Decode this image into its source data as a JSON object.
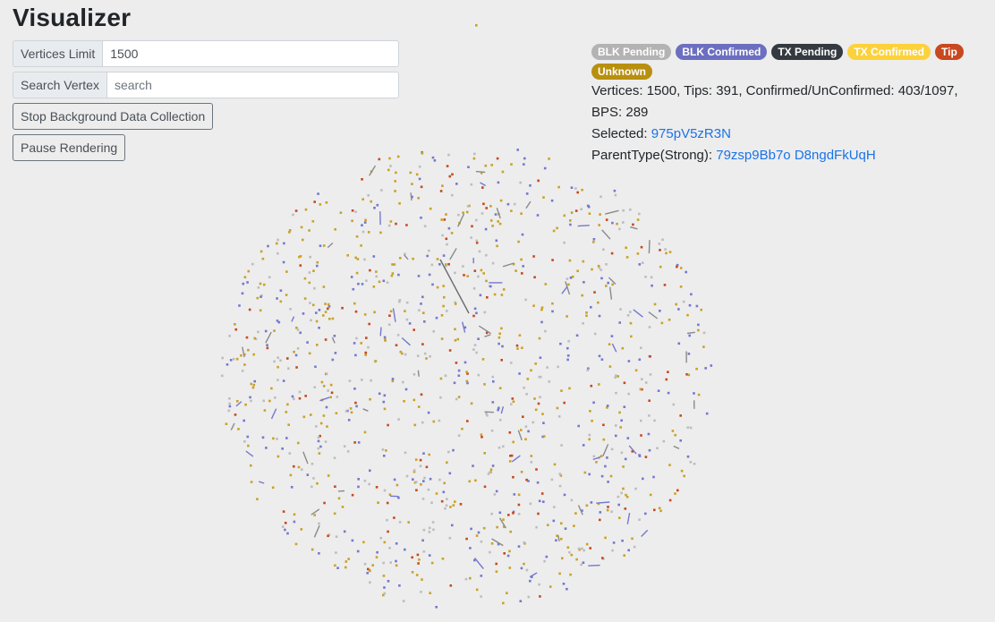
{
  "app": {
    "title": "Visualizer"
  },
  "controls": {
    "vertices_limit": {
      "label": "Vertices Limit",
      "value": "1500"
    },
    "search_vertex": {
      "label": "Search Vertex",
      "placeholder": "search"
    },
    "stop_button_label": "Stop Background Data Collection",
    "pause_button_label": "Pause Rendering"
  },
  "legend": [
    {
      "label": "BLK Pending",
      "color": "#b3b3b3"
    },
    {
      "label": "BLK Confirmed",
      "color": "#6c6fc0"
    },
    {
      "label": "TX Pending",
      "color": "#343a40"
    },
    {
      "label": "TX Confirmed",
      "color": "#fcd23c"
    },
    {
      "label": "Tip",
      "color": "#c8481f"
    },
    {
      "label": "Unknown",
      "color": "#b8900f"
    }
  ],
  "stats": {
    "vertices_label": "Vertices:",
    "vertices": "1500",
    "tips_label": "Tips:",
    "tips": "391",
    "confirmed_label": "Confirmed/UnConfirmed:",
    "confirmed_unconfirmed": "403/1097",
    "bps_label": "BPS:",
    "bps": "289",
    "selected_label": "Selected:",
    "selected_id": "975pV5zR3N",
    "parent_type_label": "ParentType(Strong):",
    "parent_ids": [
      "79zsp9Bb7o",
      "D8ngdFkUqH"
    ]
  }
}
